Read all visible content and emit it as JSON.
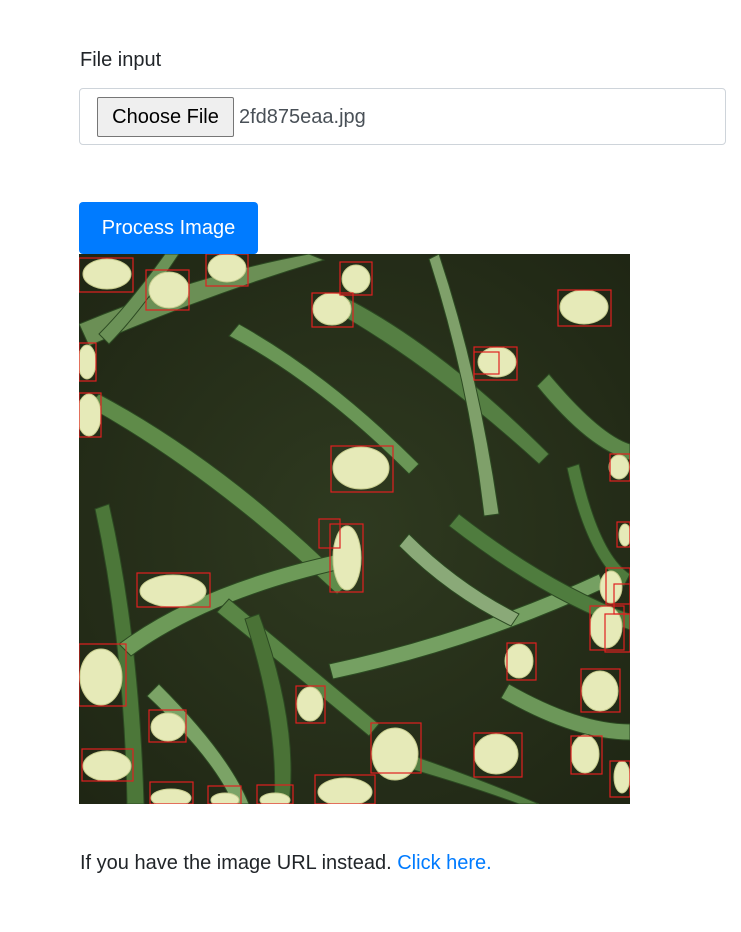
{
  "file_input": {
    "label": "File input",
    "button_label": "Choose File",
    "file_name": "2fd875eaa.jpg"
  },
  "process_button": {
    "label": "Process Image"
  },
  "result_image": {
    "detection_box_color": "#e02020",
    "detections": 44
  },
  "url_prompt": {
    "text": "If you have the image URL instead.",
    "link_label": "Click here."
  },
  "colors": {
    "primary": "#007bff",
    "text": "#212529",
    "border": "#ced4da"
  }
}
